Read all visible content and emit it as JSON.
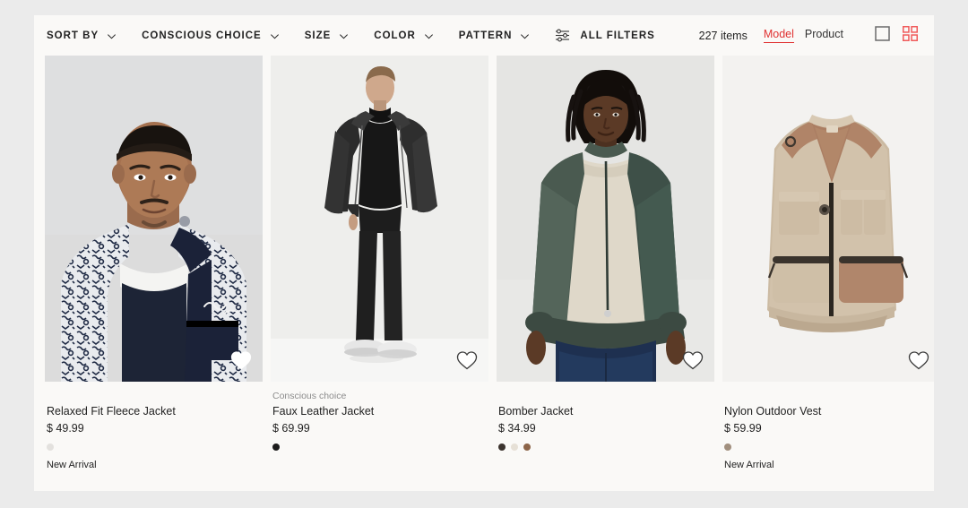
{
  "theme": {
    "page_bg": "#ebebeb",
    "panel_bg": "#faf9f7",
    "accent": "#e03232",
    "text": "#222222",
    "muted": "#8c8c8c"
  },
  "filter_bar": {
    "filters": [
      {
        "label": "SORT BY",
        "icon": "chevron-down-icon"
      },
      {
        "label": "CONSCIOUS CHOICE",
        "icon": "chevron-down-icon"
      },
      {
        "label": "SIZE",
        "icon": "chevron-down-icon"
      },
      {
        "label": "COLOR",
        "icon": "chevron-down-icon"
      },
      {
        "label": "PATTERN",
        "icon": "chevron-down-icon"
      }
    ],
    "all_filters": {
      "label": "ALL FILTERS",
      "icon": "tune-icon"
    },
    "items_count": "227 items",
    "view_modes": [
      {
        "label": "Model",
        "active": true
      },
      {
        "label": "Product",
        "active": false
      }
    ],
    "layout_icons": [
      {
        "name": "single-column-view-icon",
        "active": false,
        "color": "#6b6b6b"
      },
      {
        "name": "grid-view-icon",
        "active": true,
        "color": "#f05b5b"
      }
    ]
  },
  "products": [
    {
      "conscious_label": "",
      "name": "Relaxed Fit Fleece Jacket",
      "price": "$ 49.99",
      "swatches": [
        "#e3e1de"
      ],
      "marker": "New Arrival",
      "favorite_icon": "heart-icon",
      "favorite_filled": true,
      "image_alt": "model-wearing-patterned-fleece-jacket"
    },
    {
      "conscious_label": "Conscious choice",
      "name": "Faux Leather Jacket",
      "price": "$ 69.99",
      "swatches": [
        "#1c1c1c"
      ],
      "marker": "",
      "favorite_icon": "heart-icon",
      "favorite_filled": false,
      "image_alt": "model-wearing-black-faux-leather-jacket"
    },
    {
      "conscious_label": "",
      "name": "Bomber Jacket",
      "price": "$ 34.99",
      "swatches": [
        "#3b332e",
        "#e6e0d6",
        "#8c6448"
      ],
      "marker": "",
      "favorite_icon": "heart-icon",
      "favorite_filled": false,
      "image_alt": "model-wearing-green-bomber-jacket"
    },
    {
      "conscious_label": "",
      "name": "Nylon Outdoor Vest",
      "price": "$ 59.99",
      "swatches": [
        "#a18f7e"
      ],
      "marker": "New Arrival",
      "favorite_icon": "heart-icon",
      "favorite_filled": false,
      "image_alt": "beige-nylon-outdoor-utility-vest-flat-lay"
    }
  ]
}
